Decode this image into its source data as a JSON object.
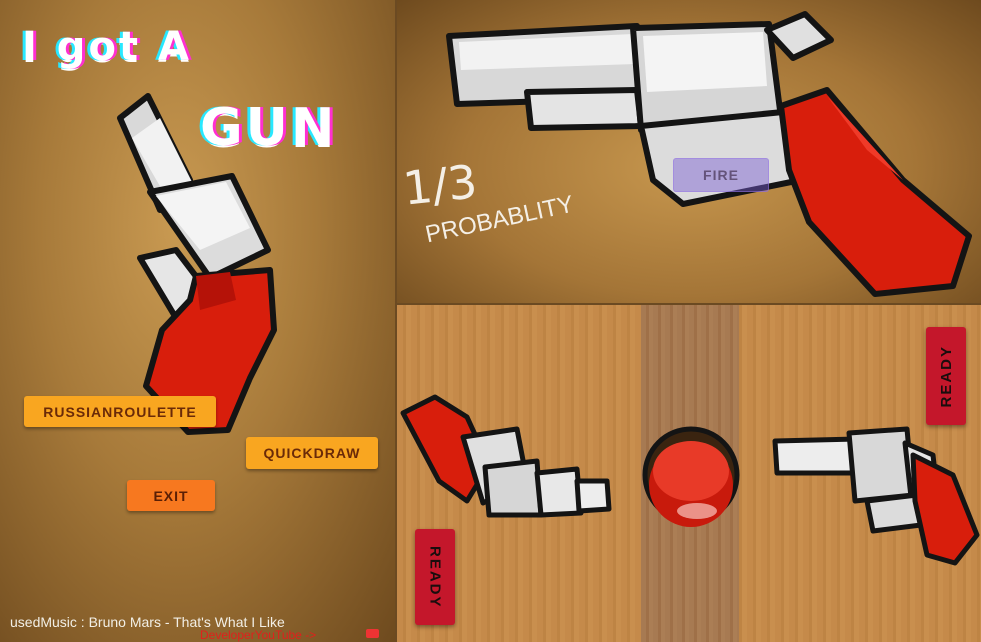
{
  "menu": {
    "title_line1": "I got A",
    "title_line2": "GUN",
    "buttons": {
      "russianroulette": "RUSSIANROULETTE",
      "quickdraw": "QUICKDRAW",
      "exit": "EXIT"
    },
    "music_credit": "usedMusic : Bruno Mars - That's What I Like",
    "developer_link": "DeveloperYouTube ->"
  },
  "fire_screen": {
    "probability_value": "1/3",
    "probability_label": "PROBABLITY",
    "fire_button": "FIRE"
  },
  "duel_screen": {
    "ready_left": "READY",
    "ready_right": "READY"
  },
  "colors": {
    "button_yellow": "#f9a620",
    "button_orange": "#f7781f",
    "ready_red": "#c4172b",
    "grip_red": "#d81e0c",
    "credit_link": "#e0201c"
  },
  "icons": {
    "gun_menu": "revolver-icon",
    "gun_fire": "revolver-icon",
    "gun_left": "revolver-icon",
    "gun_right": "revolver-icon",
    "center_button": "red-buzzer-icon",
    "youtube": "youtube-icon"
  }
}
